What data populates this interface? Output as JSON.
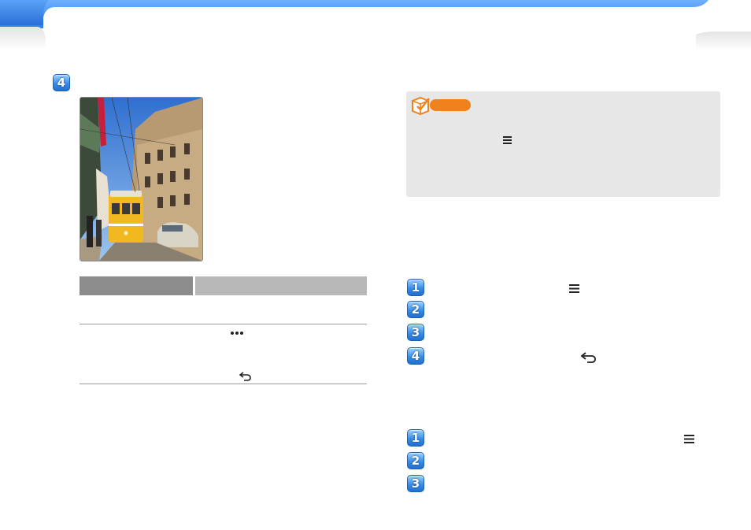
{
  "colors": {
    "top_bar": "#3f8ff0",
    "step_badge": "#3a8ee6",
    "note_accent": "#f0821e",
    "note_background": "#e7e7e7"
  },
  "left_step": {
    "number": "4"
  },
  "right_steps_a": [
    {
      "number": "1",
      "icon": "menu-icon"
    },
    {
      "number": "2"
    },
    {
      "number": "3"
    },
    {
      "number": "4",
      "icon": "back-icon"
    }
  ],
  "right_steps_b": [
    {
      "number": "1",
      "icon": "menu-icon"
    },
    {
      "number": "2"
    },
    {
      "number": "3"
    }
  ],
  "table_icons": [
    "more-icon",
    "back-icon"
  ],
  "note": {
    "icon": "note-check-icon",
    "inline_icon": "menu-icon"
  }
}
